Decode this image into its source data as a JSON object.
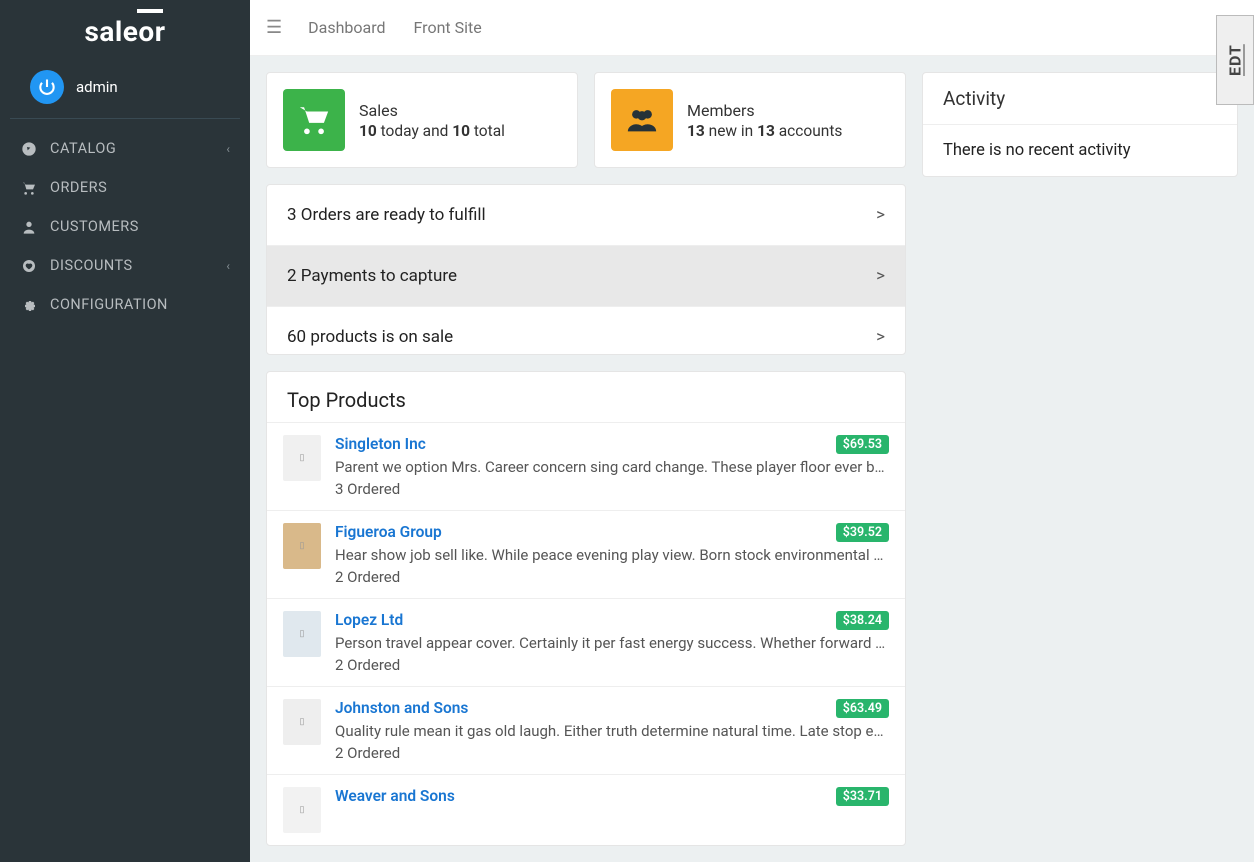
{
  "brand": "saleor",
  "user": {
    "name": "admin"
  },
  "nav": [
    {
      "label": "CATALOG",
      "icon": "compass",
      "expandable": true
    },
    {
      "label": "ORDERS",
      "icon": "cart",
      "expandable": false
    },
    {
      "label": "CUSTOMERS",
      "icon": "user",
      "expandable": false
    },
    {
      "label": "DISCOUNTS",
      "icon": "heart",
      "expandable": true
    },
    {
      "label": "CONFIGURATION",
      "icon": "gear",
      "expandable": false
    }
  ],
  "top_links": {
    "dashboard": "Dashboard",
    "front": "Front Site"
  },
  "stats": {
    "sales": {
      "title": "Sales",
      "today": "10",
      "middle": " today and ",
      "total": "10",
      "suffix": " total"
    },
    "members": {
      "title": "Members",
      "new": "13",
      "middle": " new in ",
      "accounts": "13",
      "suffix": " accounts"
    }
  },
  "alerts": [
    {
      "text": "3 Orders are ready to fulfill",
      "highlight": false
    },
    {
      "text": "2 Payments to capture",
      "highlight": true
    },
    {
      "text": "60 products is on sale",
      "highlight": false
    }
  ],
  "top_products_title": "Top Products",
  "products": [
    {
      "name": "Singleton Inc",
      "price": "$69.53",
      "desc": "Parent we option Mrs. Career concern sing card change. These player floor ever ball…",
      "ordered": "3 Ordered"
    },
    {
      "name": "Figueroa Group",
      "price": "$39.52",
      "desc": "Hear show job sell like. While peace evening play view. Born stock environmental s…",
      "ordered": "2 Ordered"
    },
    {
      "name": "Lopez Ltd",
      "price": "$38.24",
      "desc": "Person travel appear cover. Certainly it per fast energy success. Whether forward ca…",
      "ordered": "2 Ordered"
    },
    {
      "name": "Johnston and Sons",
      "price": "$63.49",
      "desc": "Quality rule mean it gas old laugh. Either truth determine natural time. Late stop ex…",
      "ordered": "2 Ordered"
    },
    {
      "name": "Weaver and Sons",
      "price": "$33.71",
      "desc": "",
      "ordered": ""
    }
  ],
  "activity": {
    "title": "Activity",
    "empty": "There is no recent activity"
  },
  "edt_label": "EDT"
}
